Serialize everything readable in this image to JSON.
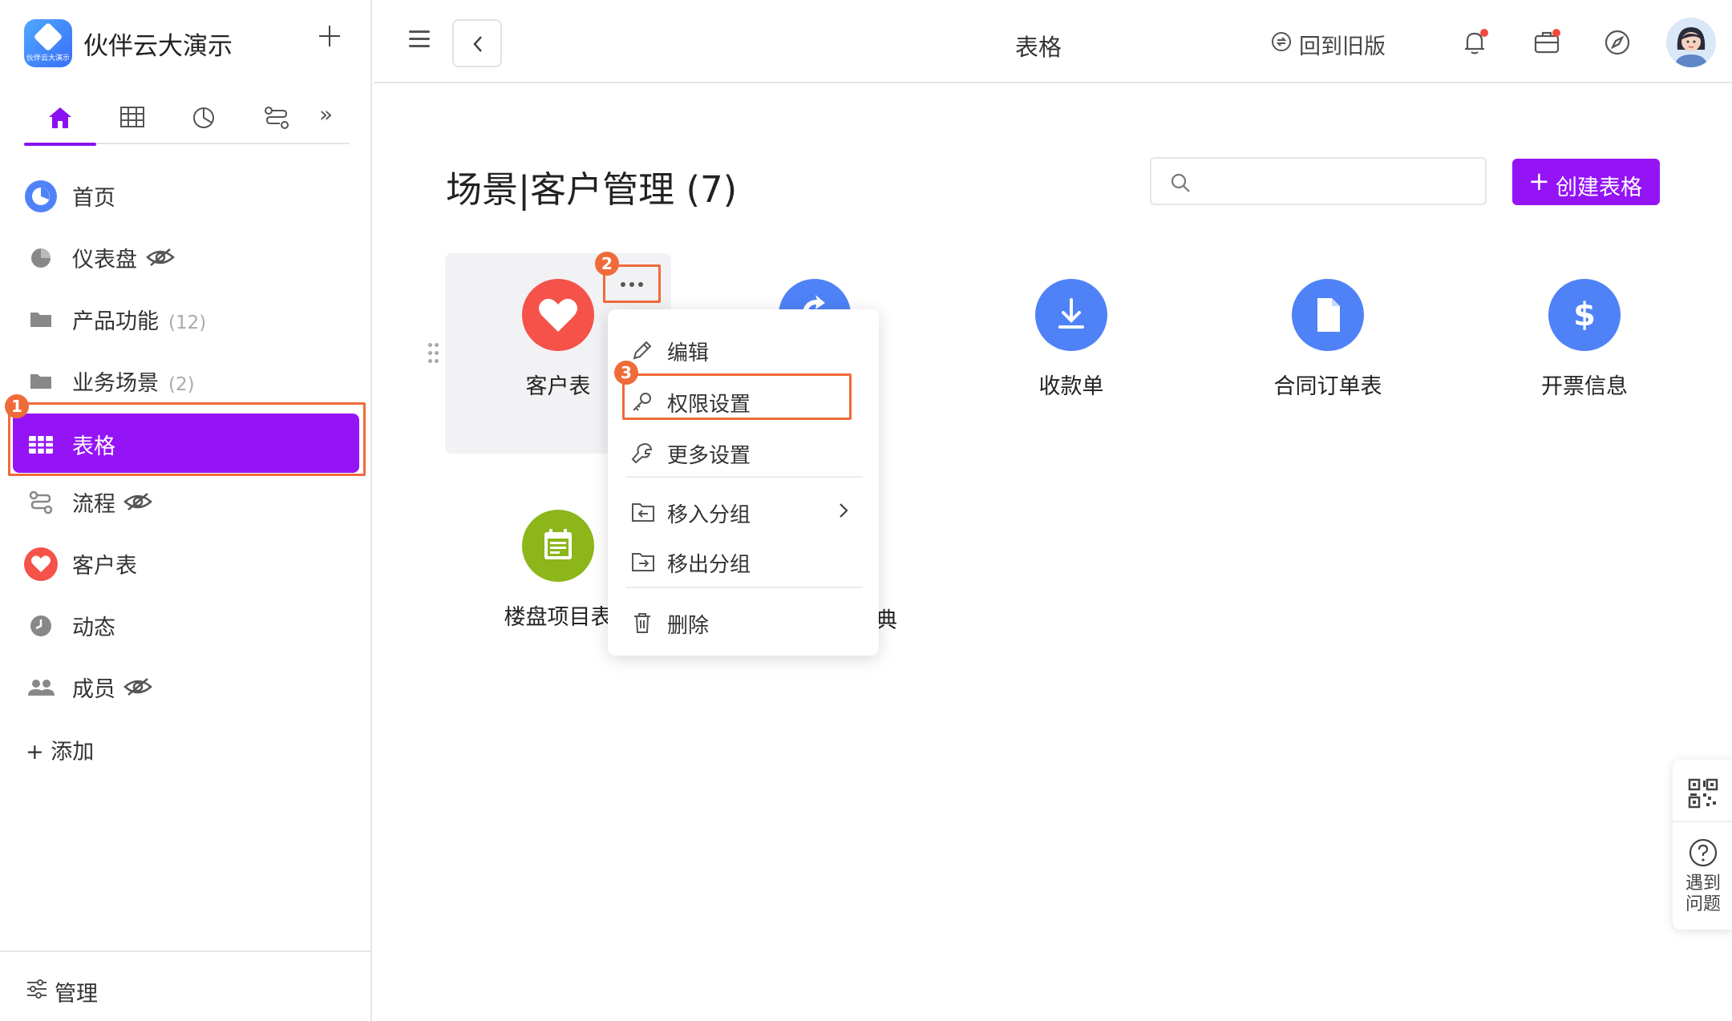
{
  "app": {
    "title": "伙伴云大演示",
    "logo_text": "伙伴云大演示"
  },
  "sidebar": {
    "tabs": [
      "home-icon",
      "table-icon",
      "chart-icon",
      "flow-icon"
    ],
    "more": "»",
    "items": [
      {
        "label": "首页",
        "count": ""
      },
      {
        "label": "仪表盘",
        "count": ""
      },
      {
        "label": "产品功能",
        "count": "(12)"
      },
      {
        "label": "业务场景",
        "count": "(2)"
      },
      {
        "label": "表格",
        "count": ""
      },
      {
        "label": "流程",
        "count": ""
      },
      {
        "label": "客户表",
        "count": ""
      },
      {
        "label": "动态",
        "count": ""
      },
      {
        "label": "成员",
        "count": ""
      }
    ],
    "add_label": "+ 添加",
    "footer_label": "管理"
  },
  "topbar": {
    "title": "表格",
    "old_version": "回到旧版"
  },
  "main": {
    "heading": "场景|客户管理 (7)",
    "search_placeholder": "",
    "create_label": "创建表格",
    "tiles": [
      {
        "name": "客户表",
        "color": "#f5524a",
        "icon": "heart-icon"
      },
      {
        "name": "",
        "color": "#4f82f7",
        "icon": "refresh-icon"
      },
      {
        "name": "收款单",
        "color": "#4f82f7",
        "icon": "download-icon"
      },
      {
        "name": "合同订单表",
        "color": "#4f82f7",
        "icon": "document-icon"
      },
      {
        "name": "开票信息",
        "color": "#4f82f7",
        "icon": "dollar-icon"
      },
      {
        "name": "楼盘项目表",
        "color": "#8cb61a",
        "icon": "calendar-icon"
      },
      {
        "name": "典",
        "color": "",
        "icon": ""
      }
    ]
  },
  "context_menu": {
    "items": [
      {
        "label": "编辑",
        "icon": "pencil-icon"
      },
      {
        "label": "权限设置",
        "icon": "key-icon"
      },
      {
        "label": "更多设置",
        "icon": "wrench-icon"
      },
      {
        "label": "移入分组",
        "icon": "folder-in-icon"
      },
      {
        "label": "移出分组",
        "icon": "folder-out-icon"
      },
      {
        "label": "删除",
        "icon": "trash-icon"
      }
    ]
  },
  "annotations": [
    "1",
    "2",
    "3"
  ],
  "float_panel": {
    "help_label": "遇到问题"
  },
  "colors": {
    "accent": "#9414f6",
    "annotation": "#ef6b3a",
    "blue": "#4f82f7"
  }
}
